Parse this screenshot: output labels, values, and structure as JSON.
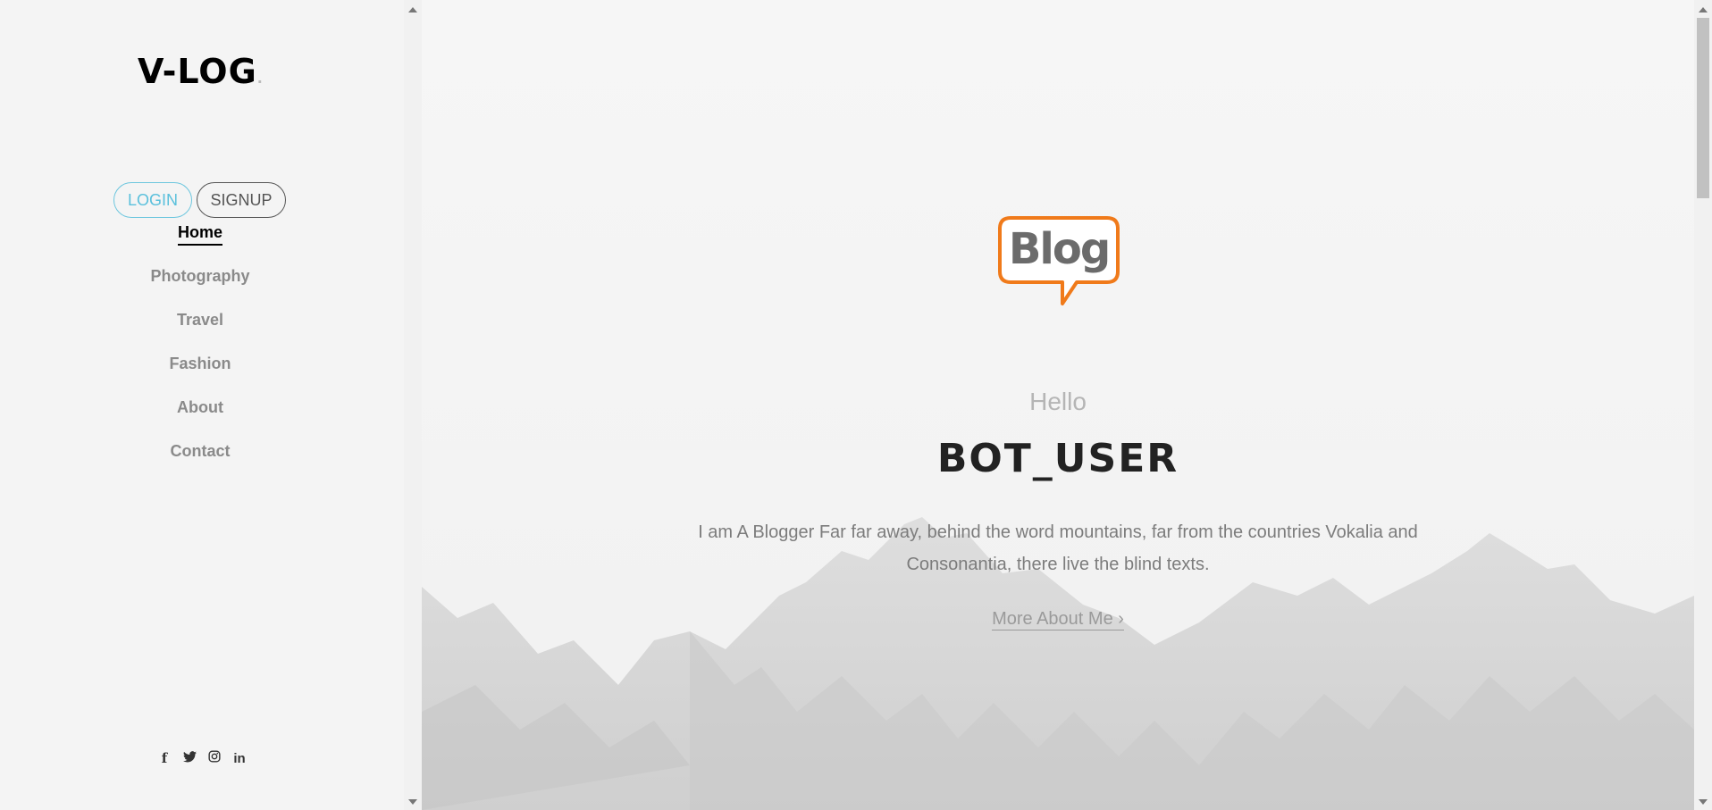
{
  "sidebar": {
    "logo_text": "V-LOG",
    "logo_dot": ".",
    "auth": {
      "login_label": "LOGIN",
      "signup_label": "SIGNUP"
    },
    "nav": [
      {
        "label": "Home",
        "active": true
      },
      {
        "label": "Photography"
      },
      {
        "label": "Travel"
      },
      {
        "label": "Fashion"
      },
      {
        "label": "About"
      },
      {
        "label": "Contact"
      }
    ],
    "social": [
      {
        "icon": "facebook-icon",
        "glyph": "f"
      },
      {
        "icon": "twitter-icon",
        "glyph": "🐦"
      },
      {
        "icon": "instagram-icon",
        "glyph": "◎"
      },
      {
        "icon": "linkedin-icon",
        "glyph": "in"
      }
    ]
  },
  "hero": {
    "blog_logo_text": "Blog",
    "greeting": "Hello",
    "username": "BOT_USER",
    "bio": "I am A Blogger Far far away, behind the word mountains, far from the countries Vokalia and Consonantia, there live the blind texts.",
    "more_link": "More About Me",
    "more_arrow": "›"
  },
  "colors": {
    "accent_login": "#5ac0dc",
    "blog_logo_orange": "#f07a1a",
    "blog_logo_gray": "#6b6b6b"
  }
}
